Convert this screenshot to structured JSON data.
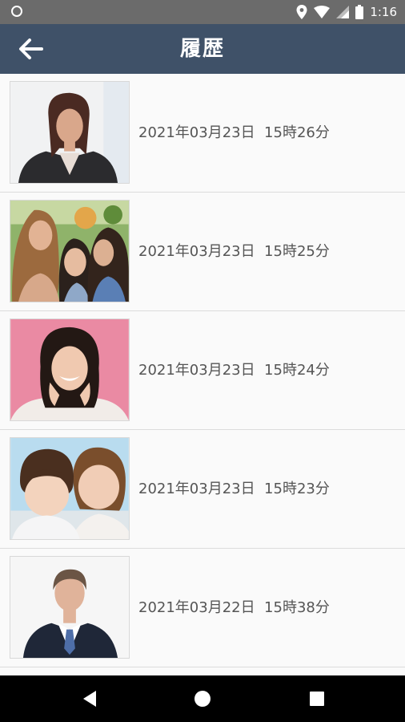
{
  "status_bar": {
    "time": "1:16"
  },
  "header": {
    "title": "履歴",
    "back_icon": "arrow-left-icon"
  },
  "history": {
    "items": [
      {
        "datetime": "2021年03月23日  15時26分",
        "photo": "woman-portrait"
      },
      {
        "datetime": "2021年03月23日  15時25分",
        "photo": "three-women-selfie"
      },
      {
        "datetime": "2021年03月23日  15時24分",
        "photo": "smiling-woman-pink-background"
      },
      {
        "datetime": "2021年03月23日  15時23分",
        "photo": "mother-and-child"
      },
      {
        "datetime": "2021年03月22日  15時38分",
        "photo": "businessman-portrait"
      }
    ]
  },
  "nav": {
    "back_icon": "triangle-back-icon",
    "home_icon": "circle-home-icon",
    "recents_icon": "square-recents-icon"
  },
  "colors": {
    "app_bar": "#3f5168",
    "status_bar": "#6b6b6b",
    "background": "#fafafa",
    "text": "#555555"
  }
}
